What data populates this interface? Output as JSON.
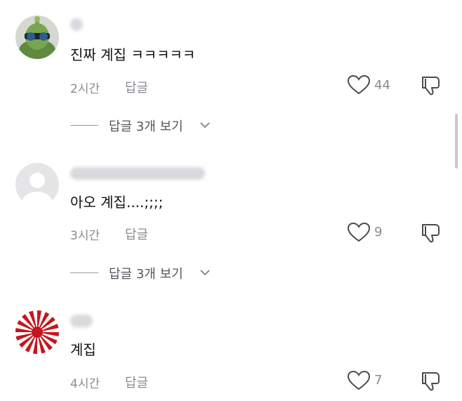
{
  "comments": [
    {
      "text": "진짜 계집 ㅋㅋㅋㅋㅋ",
      "time": "2시간",
      "reply_label": "답글",
      "likes": "44",
      "avatar_icon": "alien-sunglasses-avatar-icon",
      "view_replies": "답글 3개 보기"
    },
    {
      "text": "아오 계집....;;;;",
      "time": "3시간",
      "reply_label": "답글",
      "likes": "9",
      "avatar_icon": "default-user-avatar-icon",
      "view_replies": "답글 3개 보기"
    },
    {
      "text": "계집",
      "time": "4시간",
      "reply_label": "답글",
      "likes": "7",
      "avatar_icon": "rising-sun-flag-avatar-icon"
    }
  ],
  "colors": {
    "text": "#111111",
    "meta": "#8a8b91",
    "icon_stroke": "#4a4b52",
    "sunburst_red": "#c4161c"
  }
}
